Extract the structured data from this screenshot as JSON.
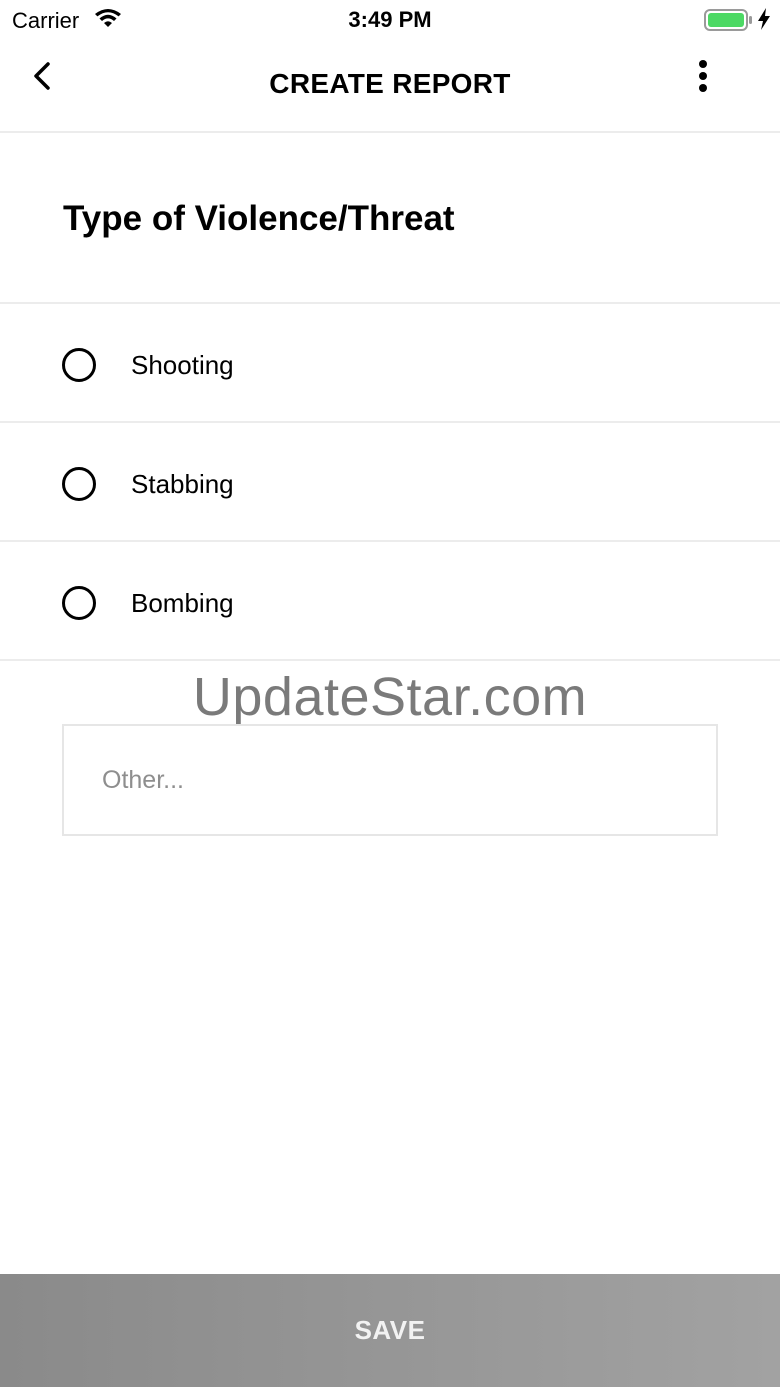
{
  "status_bar": {
    "carrier": "Carrier",
    "time": "3:49 PM",
    "icons": [
      "wifi-icon",
      "battery-icon",
      "charging-icon"
    ],
    "battery_color": "#4cd964"
  },
  "nav": {
    "title": "CREATE REPORT",
    "back_icon": "chevron-left-icon",
    "more_icon": "more-vertical-icon"
  },
  "section": {
    "title": "Type of Violence/Threat"
  },
  "options": [
    {
      "label": "Shooting",
      "selected": false
    },
    {
      "label": "Stabbing",
      "selected": false
    },
    {
      "label": "Bombing",
      "selected": false
    }
  ],
  "watermark": "UpdateStar.com",
  "other_input": {
    "value": "",
    "placeholder": "Other..."
  },
  "save": {
    "label": "SAVE",
    "colors": [
      "#8a8a8a",
      "#a2a2a2"
    ]
  }
}
